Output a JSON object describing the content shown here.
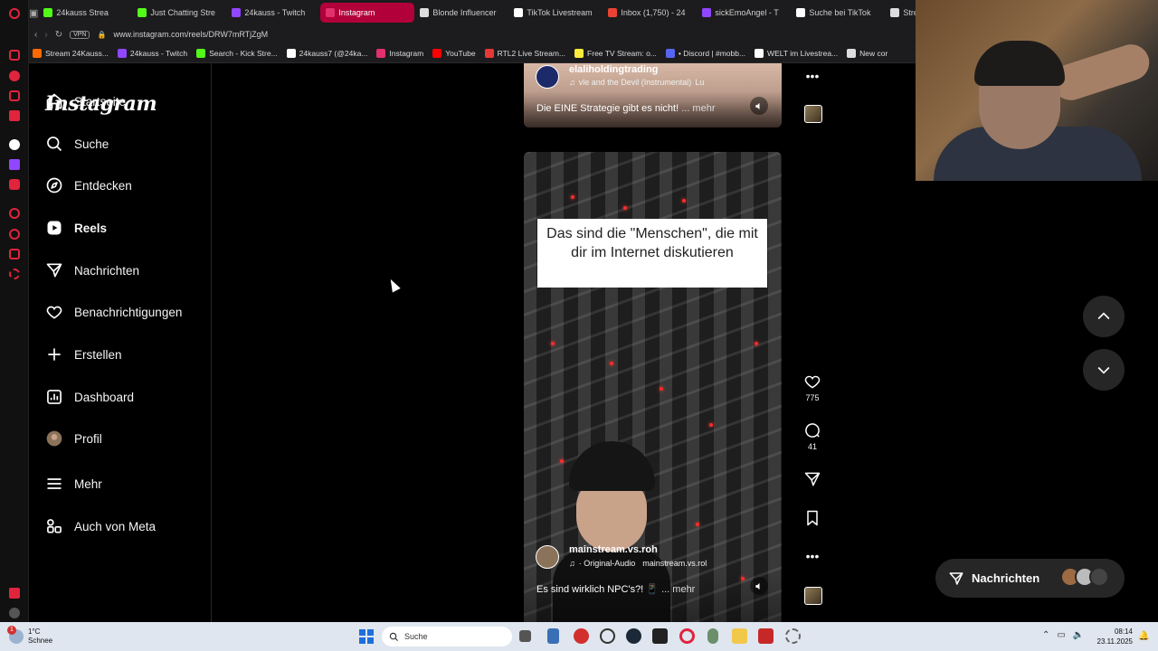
{
  "browser": {
    "tabs": [
      {
        "label": "24kauss Strea",
        "color": "#53fc18"
      },
      {
        "label": "Just Chatting Stre",
        "color": "#53fc18"
      },
      {
        "label": "24kauss - Twitch",
        "color": "#9146ff"
      },
      {
        "label": "Instagram",
        "color": "#e1306c",
        "active": true
      },
      {
        "label": "Blonde Influencer",
        "color": "#dddddd"
      },
      {
        "label": "TikTok Livestream",
        "color": "#ffffff"
      },
      {
        "label": "Inbox (1,750) - 24",
        "color": "#ea4335"
      },
      {
        "label": "sickEmoAngel - T",
        "color": "#9146ff"
      },
      {
        "label": "Suche bei TikTok",
        "color": "#ffffff"
      },
      {
        "label": "Strea",
        "color": "#dddddd"
      }
    ],
    "url": "www.instagram.com/reels/DRW7mRTjZgM",
    "vpn_label": "VPN",
    "bookmarks": [
      {
        "label": "Stream 24Kauss...",
        "color": "#ff6a00"
      },
      {
        "label": "24kauss - Twitch",
        "color": "#9146ff"
      },
      {
        "label": "Search - Kick Stre...",
        "color": "#53fc18"
      },
      {
        "label": "24kauss7 (@24ka...",
        "color": "#ffffff"
      },
      {
        "label": "Instagram",
        "color": "#e1306c"
      },
      {
        "label": "YouTube",
        "color": "#ff0000"
      },
      {
        "label": "RTL2 Live Stream...",
        "color": "#e53935"
      },
      {
        "label": "Free TV Stream: o...",
        "color": "#ffeb3b"
      },
      {
        "label": "• Discord | #mobb...",
        "color": "#5865f2"
      },
      {
        "label": "WELT im Livestrea...",
        "color": "#ffffff"
      },
      {
        "label": "New cor",
        "color": "#dddddd"
      }
    ]
  },
  "instagram": {
    "logo": "Instagram",
    "nav": [
      {
        "label": "Startseite",
        "icon": "home-icon"
      },
      {
        "label": "Suche",
        "icon": "search-icon"
      },
      {
        "label": "Entdecken",
        "icon": "compass-icon"
      },
      {
        "label": "Reels",
        "icon": "reels-icon",
        "active": true
      },
      {
        "label": "Nachrichten",
        "icon": "send-icon"
      },
      {
        "label": "Benachrichtigungen",
        "icon": "heart-icon"
      },
      {
        "label": "Erstellen",
        "icon": "plus-icon"
      },
      {
        "label": "Dashboard",
        "icon": "dashboard-icon"
      },
      {
        "label": "Profil",
        "icon": "avatar"
      },
      {
        "label": "Mehr",
        "icon": "menu-icon"
      },
      {
        "label": "Auch von Meta",
        "icon": "meta-apps-icon"
      }
    ]
  },
  "reels": {
    "prev": {
      "username": "elaliholdingtrading",
      "audio": "vle and the Devil (Instrumental)",
      "audio_extra": "Lu",
      "caption": "Die EINE Strategie gibt es nicht!",
      "more": "... mehr"
    },
    "current": {
      "overlay_text": "Das sind die \"Menschen\", die mit dir im Internet diskutieren",
      "username": "mainstream.vs.roh",
      "audio": "· Original-Audio",
      "audio_extra": "mainstream.vs.rol",
      "caption": "Es sind wirklich NPC's?! 📱",
      "more": "... mehr",
      "likes": "775",
      "comments": "41"
    }
  },
  "messages_pill": {
    "label": "Nachrichten"
  },
  "taskbar": {
    "weather_temp": "1°C",
    "weather_text": "Schnee",
    "notification_count": "1",
    "search_label": "Suche",
    "time": "08:14",
    "date": "23.11.2025"
  }
}
